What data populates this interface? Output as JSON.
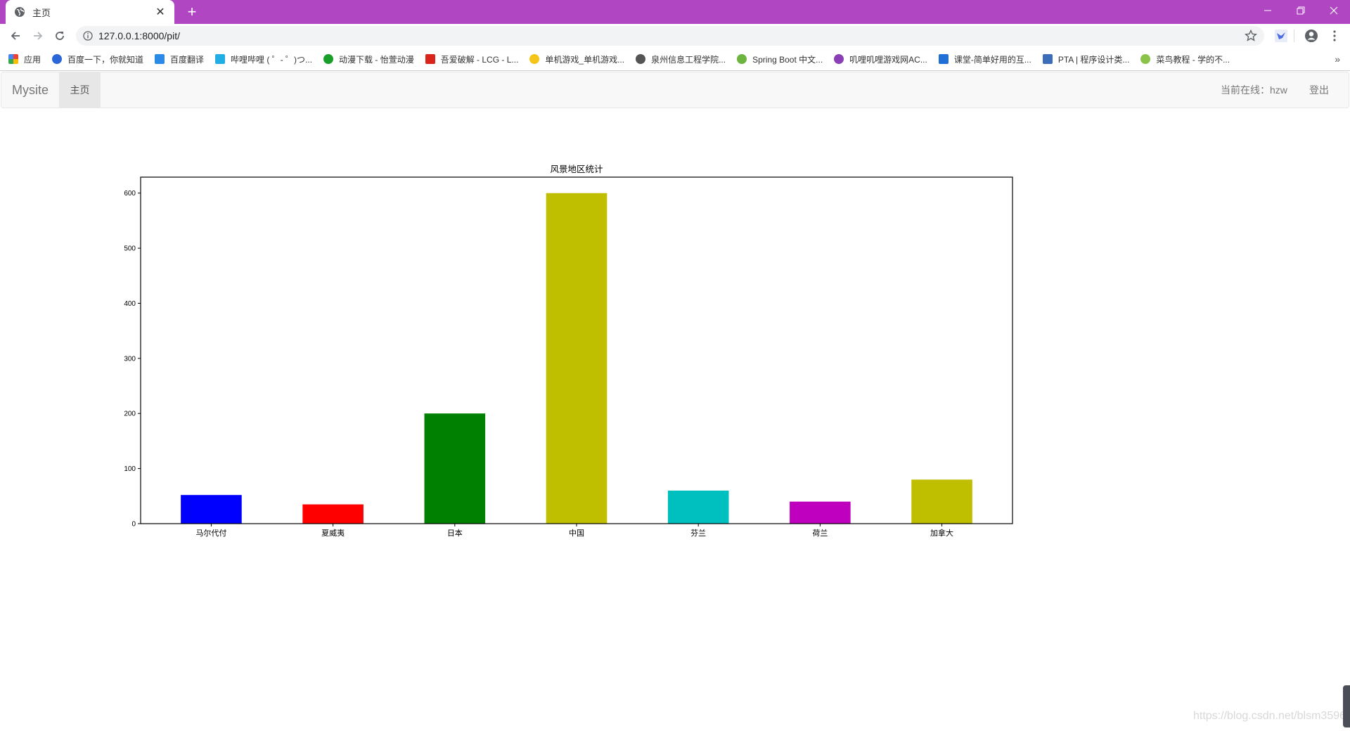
{
  "browser": {
    "tab_title": "主页",
    "new_tab_label": "+",
    "url": "127.0.0.1:8000/pit/",
    "colors": {
      "frame": "#b146c2"
    },
    "bookmarks": [
      {
        "label": "应用",
        "icon": "apps-grid-icon",
        "color": "#4285f4"
      },
      {
        "label": "百度一下，你就知道",
        "icon": "baidu-paw-icon",
        "color": "#2b66d9"
      },
      {
        "label": "百度翻译",
        "icon": "translate-icon",
        "color": "#2b8ae6"
      },
      {
        "label": "哔哩哔哩 ( ゜- ゜)つ...",
        "icon": "bilibili-icon",
        "color": "#23ade5"
      },
      {
        "label": "动漫下载 - 怡萱动漫",
        "icon": "leaf-icon",
        "color": "#1a9e2a"
      },
      {
        "label": "吾爱破解 - LCG - L...",
        "icon": "52pojie-icon",
        "color": "#d9241b"
      },
      {
        "label": "单机游戏_单机游戏...",
        "icon": "trophy-icon",
        "color": "#f5c518"
      },
      {
        "label": "泉州信息工程学院...",
        "icon": "globe-icon",
        "color": "#555555"
      },
      {
        "label": "Spring Boot 中文...",
        "icon": "spring-icon",
        "color": "#6db33f"
      },
      {
        "label": "叽哩叽哩游戏网AC...",
        "icon": "ac-icon",
        "color": "#8a3fb5"
      },
      {
        "label": "课堂-简单好用的互...",
        "icon": "ketang-icon",
        "color": "#1f6fd6"
      },
      {
        "label": "PTA | 程序设计类...",
        "icon": "pta-icon",
        "color": "#3b6db8"
      },
      {
        "label": "菜鸟教程 - 学的不...",
        "icon": "runoob-icon",
        "color": "#8bc34a"
      }
    ]
  },
  "site": {
    "brand": "Mysite",
    "nav_active": "主页",
    "online_text": "当前在线：hzw",
    "logout": "登出"
  },
  "watermark": "https://blog.csdn.net/blsm3596",
  "chart_data": {
    "type": "bar",
    "title": "风景地区统计",
    "xlabel": "",
    "ylabel": "",
    "categories": [
      "马尔代付",
      "夏威夷",
      "日本",
      "中国",
      "芬兰",
      "荷兰",
      "加拿大"
    ],
    "values": [
      52,
      35,
      200,
      600,
      60,
      40,
      80
    ],
    "colors": [
      "#0000ff",
      "#ff0000",
      "#008000",
      "#bfbf00",
      "#00bfbf",
      "#bf00bf",
      "#bfbf00"
    ],
    "ylim": [
      0,
      629
    ],
    "xlim": [
      -0.58,
      6.58
    ],
    "yticks": [
      0,
      100,
      200,
      300,
      400,
      500,
      600
    ],
    "grid": false,
    "legend": "none"
  }
}
